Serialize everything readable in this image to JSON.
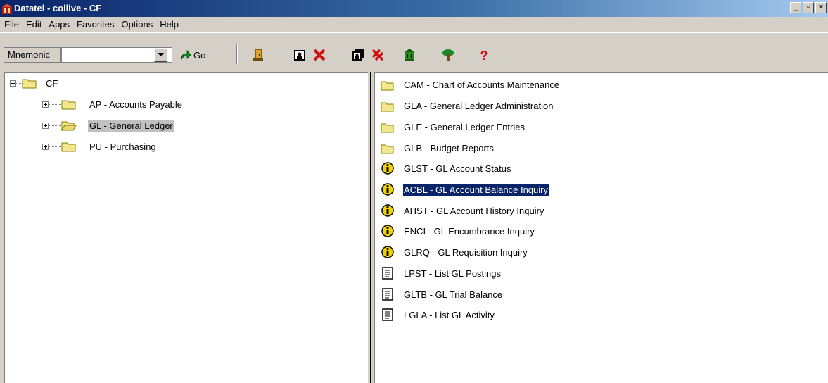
{
  "window": {
    "title": "Datatel - collive - CF"
  },
  "window_buttons": {
    "minimize": "_",
    "maximize": "▫",
    "close": "×"
  },
  "menu": [
    "File",
    "Edit",
    "Apps",
    "Favorites",
    "Options",
    "Help"
  ],
  "toolbar": {
    "mnemonic_label": "Mnemonic",
    "mnemonic_value": "",
    "go_label": "Go",
    "icons": [
      "exit-door-icon",
      "person-card-icon",
      "cancel-x-icon",
      "person-pages-icon",
      "cancel-all-icon",
      "building-icon",
      "tree-icon",
      "help-question-icon"
    ]
  },
  "tree": {
    "root": "CF",
    "children": [
      {
        "label": "AP - Accounts Payable",
        "expanded": false,
        "selected": false
      },
      {
        "label": "GL - General Ledger",
        "expanded": false,
        "selected": true
      },
      {
        "label": "PU - Purchasing",
        "expanded": false,
        "selected": false
      }
    ]
  },
  "list": {
    "items": [
      {
        "label": "CAM - Chart of Accounts Maintenance",
        "icon": "folder-icon"
      },
      {
        "label": "GLA - General Ledger Administration",
        "icon": "folder-icon"
      },
      {
        "label": "GLE - General Ledger Entries",
        "icon": "folder-icon"
      },
      {
        "label": "GLB - Budget Reports",
        "icon": "folder-icon"
      },
      {
        "label": "GLST - GL Account Status",
        "icon": "info-icon"
      },
      {
        "label": "ACBL - GL Account Balance Inquiry",
        "icon": "info-icon",
        "selected": true
      },
      {
        "label": "AHST - GL Account History Inquiry",
        "icon": "info-icon"
      },
      {
        "label": "ENCI - GL Encumbrance Inquiry",
        "icon": "info-icon"
      },
      {
        "label": "GLRQ - GL Requisition Inquiry",
        "icon": "info-icon"
      },
      {
        "label": "LPST - List GL Postings",
        "icon": "report-icon"
      },
      {
        "label": "GLTB - GL Trial Balance",
        "icon": "report-icon"
      },
      {
        "label": "LGLA - List GL Activity",
        "icon": "report-icon"
      }
    ]
  },
  "colors": {
    "selection": "#0a246a",
    "folder": "#f4e68c",
    "info": "#f2d300"
  }
}
